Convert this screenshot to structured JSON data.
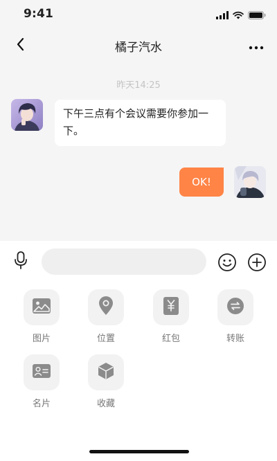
{
  "status_bar": {
    "time": "9:41",
    "icons": [
      "signal-icon",
      "wifi-icon",
      "battery-icon"
    ]
  },
  "header": {
    "title": "橘子汽水",
    "back_icon": "chevron-left-icon",
    "more_icon": "more-horizontal-icon"
  },
  "chat": {
    "timestamp": "昨天14:25",
    "messages": [
      {
        "side": "left",
        "text": "下午三点有个会议需要你参加一下。"
      },
      {
        "side": "right",
        "text": "OK!"
      }
    ]
  },
  "composer": {
    "input_value": "",
    "mic_icon": "microphone-icon",
    "emoji_icon": "emoji-icon",
    "plus_icon": "plus-circle-icon"
  },
  "tools": [
    {
      "label": "图片",
      "icon": "image-icon"
    },
    {
      "label": "位置",
      "icon": "location-pin-icon"
    },
    {
      "label": "红包",
      "icon": "red-envelope-icon"
    },
    {
      "label": "转账",
      "icon": "transfer-icon"
    },
    {
      "label": "名片",
      "icon": "contact-card-icon"
    },
    {
      "label": "收藏",
      "icon": "favorites-cube-icon"
    }
  ],
  "colors": {
    "accent": "#ff8446",
    "chat_background": "#f5f5f5",
    "panel_background": "#ffffff",
    "tile_background": "#f2f2f2",
    "icon_gray": "#888888"
  }
}
